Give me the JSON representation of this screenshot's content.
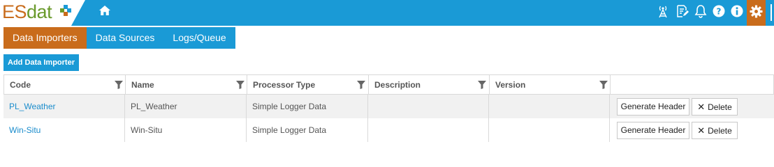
{
  "app": {
    "logo_e": "E",
    "logo_s": "S",
    "logo_dat": "dat"
  },
  "topbar": {
    "icons": [
      "home-icon",
      "antenna-icon",
      "edit-document-icon",
      "bell-icon",
      "help-icon",
      "info-icon",
      "gear-icon"
    ],
    "colors": {
      "bar": "#1a9ad6",
      "accent": "#c96c1c"
    }
  },
  "tabs": [
    {
      "label": "Data Importers",
      "active": true
    },
    {
      "label": "Data Sources",
      "active": false
    },
    {
      "label": "Logs/Queue",
      "active": false
    }
  ],
  "toolbar": {
    "add_label": "Add Data Importer"
  },
  "table": {
    "columns": [
      "Code",
      "Name",
      "Processor Type",
      "Description",
      "Version"
    ],
    "rows": [
      {
        "code": "PL_Weather",
        "name": "PL_Weather",
        "processor": "Simple Logger Data",
        "description": "",
        "version": ""
      },
      {
        "code": "Win-Situ",
        "name": "Win-Situ",
        "processor": "Simple Logger Data",
        "description": "",
        "version": ""
      }
    ],
    "generate_label": "Generate Header",
    "delete_label": "Delete"
  }
}
